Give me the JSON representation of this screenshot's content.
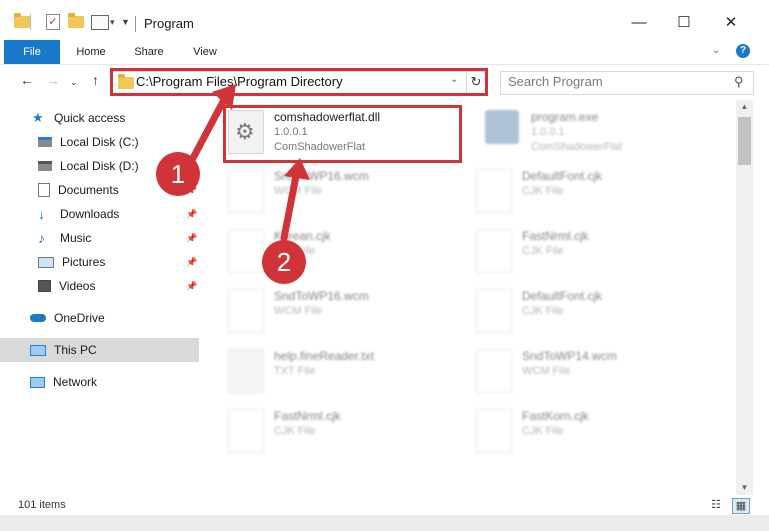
{
  "window": {
    "title": "Program",
    "minimize_icon": "minimize-icon",
    "maximize_icon": "maximize-icon",
    "close_icon": "close-icon"
  },
  "ribbon": {
    "tabs": [
      "File",
      "Home",
      "Share",
      "View"
    ],
    "help_label": "?"
  },
  "address": {
    "path": "C:\\Program Files\\Program Directory",
    "search_placeholder": "Search Program"
  },
  "sidebar": {
    "items": [
      {
        "label": "Quick access",
        "icon": "star-icon"
      },
      {
        "label": "Local Disk (C:)",
        "icon": "drive-icon"
      },
      {
        "label": "Local Disk (D:)",
        "icon": "drive-icon"
      },
      {
        "label": "Documents",
        "icon": "documents-icon"
      },
      {
        "label": "Downloads",
        "icon": "download-icon"
      },
      {
        "label": "Music",
        "icon": "music-icon"
      },
      {
        "label": "Pictures",
        "icon": "pictures-icon"
      },
      {
        "label": "Videos",
        "icon": "videos-icon"
      },
      {
        "label": "OneDrive",
        "icon": "cloud-icon"
      },
      {
        "label": "This PC",
        "icon": "computer-icon"
      },
      {
        "label": "Network",
        "icon": "network-icon"
      }
    ]
  },
  "files": {
    "highlighted": {
      "name": "comshadowerflat.dll",
      "version": "1.0.0.1",
      "company": "ComShadowerFlat"
    },
    "exe": {
      "name": "program.exe",
      "version": "1.0.0.1",
      "company": "ComShadowerFlat"
    },
    "left_column": [
      {
        "name": "SndToWP16.wcm",
        "type": "WCM File"
      },
      {
        "name": "Korean.cjk",
        "type": "CJK File"
      },
      {
        "name": "SndToWP16.wcm",
        "type": "WCM File"
      },
      {
        "name": "help.fineReader.txt",
        "type": "TXT File"
      },
      {
        "name": "FastNrml.cjk",
        "type": "CJK File"
      }
    ],
    "right_column": [
      {
        "name": "DefaultFont.cjk",
        "type": "CJK File"
      },
      {
        "name": "FastNrml.cjk",
        "type": "CJK File"
      },
      {
        "name": "DefaultFont.cjk",
        "type": "CJK File"
      },
      {
        "name": "SndToWP14.wcm",
        "type": "WCM File"
      },
      {
        "name": "FastKorn.cjk",
        "type": "CJK File"
      }
    ]
  },
  "status": {
    "items_count": "101 items"
  },
  "callouts": {
    "step1": "1",
    "step2": "2"
  },
  "colors": {
    "accent": "#1979ca",
    "highlight_red": "#d13438"
  }
}
